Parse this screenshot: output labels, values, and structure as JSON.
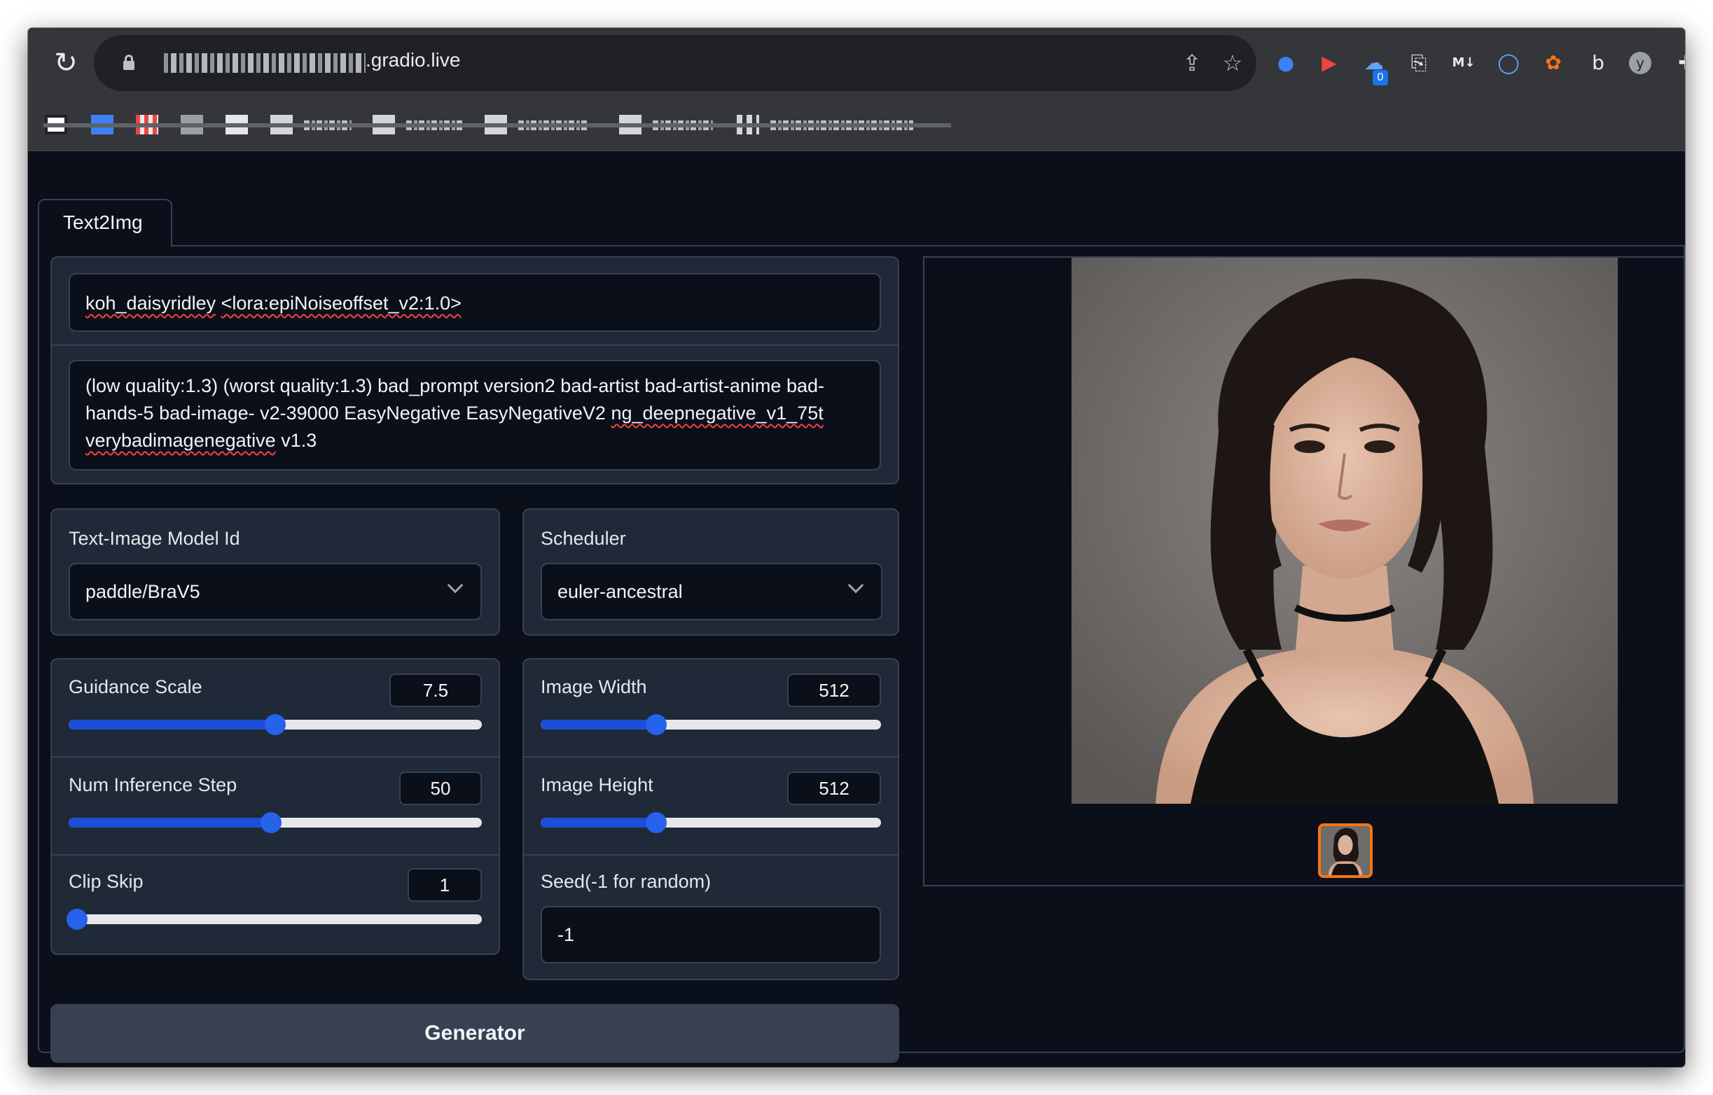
{
  "browser": {
    "url_domain": ".gradio.live",
    "bookmarks_count": 10,
    "extensions": [
      "cookie-icon",
      "youtube-icon",
      "cloud-sync-icon",
      "clipboard-icon",
      "markdown-icon",
      "chat-icon",
      "flower-icon",
      "bing-icon",
      "y-icon",
      "puzzle-icon"
    ],
    "badge_count": "0"
  },
  "tabs": [
    {
      "label": "Text2Img"
    }
  ],
  "prompt": {
    "positive_parts": [
      "koh_daisyridley",
      " ",
      "<lora:epiNoiseoffset_v2:1.0>"
    ],
    "negative_parts": [
      "(low quality:1.3) (worst quality:1.3) bad_prompt version2 bad-artist bad-artist-anime bad-hands-5 bad-image- v2-39000 EasyNegative EasyNegativeV2 ",
      "ng_deepnegative_v1_75t",
      " ",
      "verybadimagenegative",
      " v1.3"
    ]
  },
  "model": {
    "label": "Text-Image Model Id",
    "value": "paddle/BraV5"
  },
  "scheduler": {
    "label": "Scheduler",
    "value": "euler-ancestral"
  },
  "guidance": {
    "label": "Guidance Scale",
    "value": "7.5",
    "fraction": 0.5
  },
  "steps": {
    "label": "Num Inference Step",
    "value": "50",
    "fraction": 0.49
  },
  "clip": {
    "label": "Clip Skip",
    "value": "1",
    "fraction": 0.02
  },
  "width": {
    "label": "Image Width",
    "value": "512",
    "fraction": 0.34
  },
  "height": {
    "label": "Image Height",
    "value": "512",
    "fraction": 0.34
  },
  "seed": {
    "label": "Seed(-1 for random)",
    "value": "-1"
  },
  "generate": {
    "label": "Generator"
  },
  "colors": {
    "accent": "#2563eb",
    "thumb_border": "#f97316",
    "panel": "#1f2937",
    "bg": "#0b0f19"
  }
}
